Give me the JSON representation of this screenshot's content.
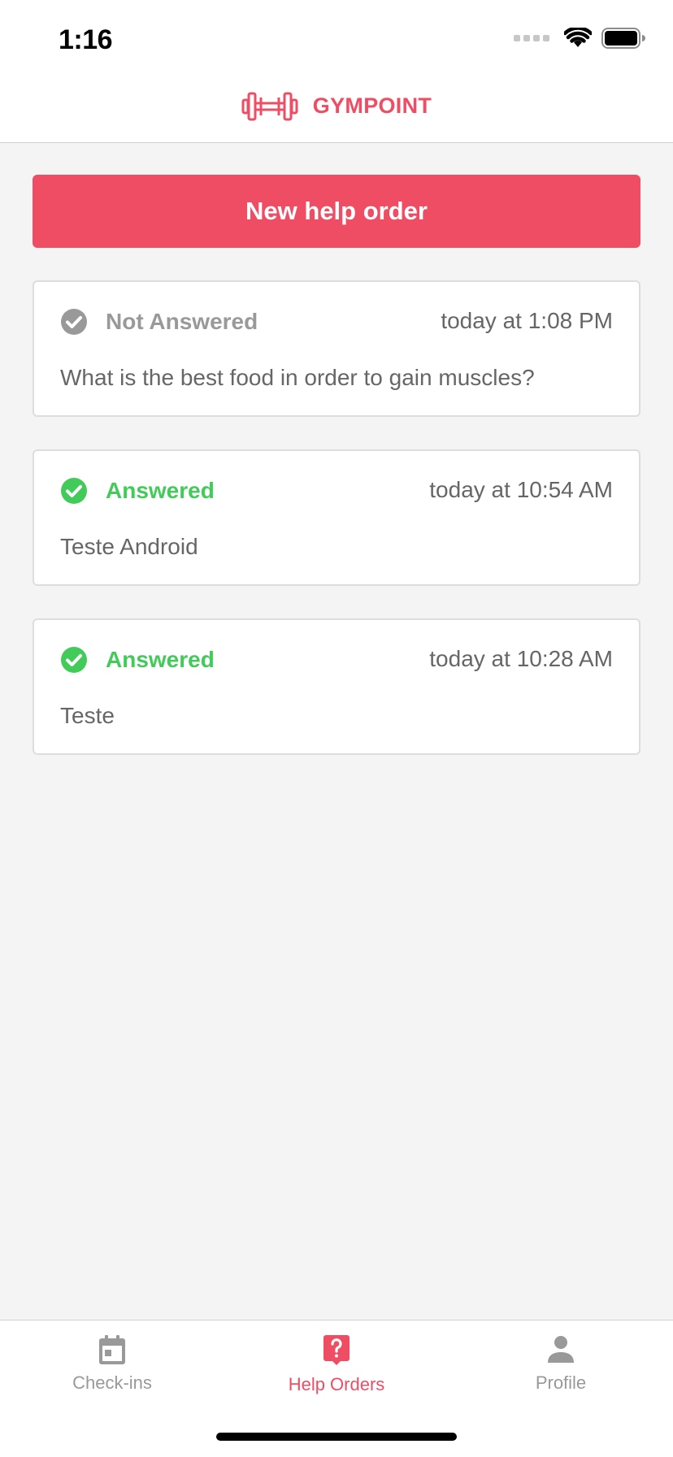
{
  "status_bar": {
    "time": "1:16"
  },
  "header": {
    "brand": "GYMPOINT",
    "logo_icon": "dumbbell-icon"
  },
  "actions": {
    "new_help_order": "New help order"
  },
  "help_orders": [
    {
      "status": "Not Answered",
      "status_color": "#999999",
      "status_icon": "check-circle-icon",
      "date": "today at 1:08 PM",
      "question": "What is the best food in order to gain muscles?"
    },
    {
      "status": "Answered",
      "status_color": "#42cb59",
      "status_icon": "check-circle-icon",
      "date": "today at 10:54 AM",
      "question": "Teste Android"
    },
    {
      "status": "Answered",
      "status_color": "#42cb59",
      "status_icon": "check-circle-icon",
      "date": "today at 10:28 AM",
      "question": "Teste"
    }
  ],
  "tabs": [
    {
      "label": "Check-ins",
      "icon": "calendar-icon",
      "active": false
    },
    {
      "label": "Help Orders",
      "icon": "help-icon",
      "active": true
    },
    {
      "label": "Profile",
      "icon": "person-icon",
      "active": false
    }
  ],
  "colors": {
    "accent": "#ee4d64",
    "answered": "#42cb59",
    "not_answered": "#999999",
    "tab_inactive": "#999999"
  }
}
